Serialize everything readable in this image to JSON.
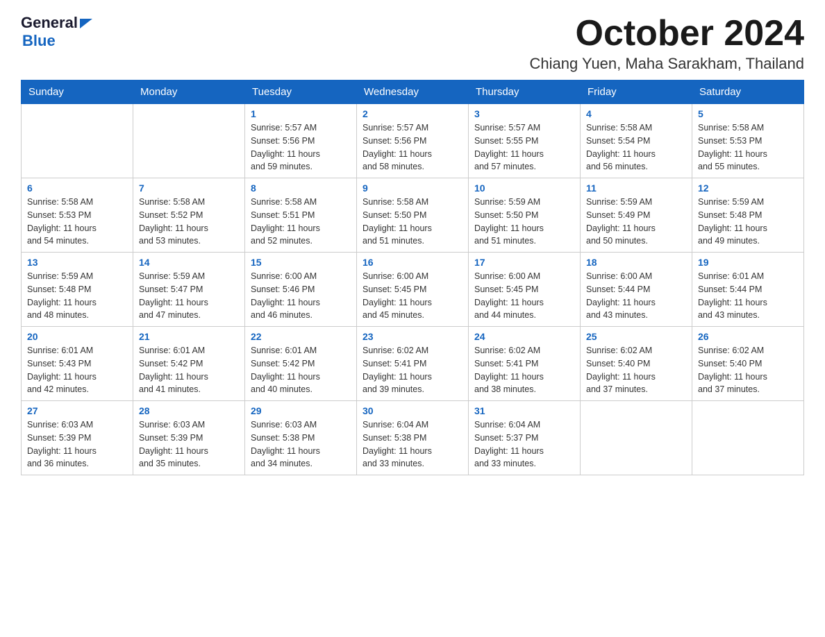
{
  "header": {
    "logo_general": "General",
    "logo_blue": "Blue",
    "title": "October 2024",
    "location": "Chiang Yuen, Maha Sarakham, Thailand"
  },
  "weekdays": [
    "Sunday",
    "Monday",
    "Tuesday",
    "Wednesday",
    "Thursday",
    "Friday",
    "Saturday"
  ],
  "weeks": [
    [
      {
        "day": "",
        "info": ""
      },
      {
        "day": "",
        "info": ""
      },
      {
        "day": "1",
        "info": "Sunrise: 5:57 AM\nSunset: 5:56 PM\nDaylight: 11 hours\nand 59 minutes."
      },
      {
        "day": "2",
        "info": "Sunrise: 5:57 AM\nSunset: 5:56 PM\nDaylight: 11 hours\nand 58 minutes."
      },
      {
        "day": "3",
        "info": "Sunrise: 5:57 AM\nSunset: 5:55 PM\nDaylight: 11 hours\nand 57 minutes."
      },
      {
        "day": "4",
        "info": "Sunrise: 5:58 AM\nSunset: 5:54 PM\nDaylight: 11 hours\nand 56 minutes."
      },
      {
        "day": "5",
        "info": "Sunrise: 5:58 AM\nSunset: 5:53 PM\nDaylight: 11 hours\nand 55 minutes."
      }
    ],
    [
      {
        "day": "6",
        "info": "Sunrise: 5:58 AM\nSunset: 5:53 PM\nDaylight: 11 hours\nand 54 minutes."
      },
      {
        "day": "7",
        "info": "Sunrise: 5:58 AM\nSunset: 5:52 PM\nDaylight: 11 hours\nand 53 minutes."
      },
      {
        "day": "8",
        "info": "Sunrise: 5:58 AM\nSunset: 5:51 PM\nDaylight: 11 hours\nand 52 minutes."
      },
      {
        "day": "9",
        "info": "Sunrise: 5:58 AM\nSunset: 5:50 PM\nDaylight: 11 hours\nand 51 minutes."
      },
      {
        "day": "10",
        "info": "Sunrise: 5:59 AM\nSunset: 5:50 PM\nDaylight: 11 hours\nand 51 minutes."
      },
      {
        "day": "11",
        "info": "Sunrise: 5:59 AM\nSunset: 5:49 PM\nDaylight: 11 hours\nand 50 minutes."
      },
      {
        "day": "12",
        "info": "Sunrise: 5:59 AM\nSunset: 5:48 PM\nDaylight: 11 hours\nand 49 minutes."
      }
    ],
    [
      {
        "day": "13",
        "info": "Sunrise: 5:59 AM\nSunset: 5:48 PM\nDaylight: 11 hours\nand 48 minutes."
      },
      {
        "day": "14",
        "info": "Sunrise: 5:59 AM\nSunset: 5:47 PM\nDaylight: 11 hours\nand 47 minutes."
      },
      {
        "day": "15",
        "info": "Sunrise: 6:00 AM\nSunset: 5:46 PM\nDaylight: 11 hours\nand 46 minutes."
      },
      {
        "day": "16",
        "info": "Sunrise: 6:00 AM\nSunset: 5:45 PM\nDaylight: 11 hours\nand 45 minutes."
      },
      {
        "day": "17",
        "info": "Sunrise: 6:00 AM\nSunset: 5:45 PM\nDaylight: 11 hours\nand 44 minutes."
      },
      {
        "day": "18",
        "info": "Sunrise: 6:00 AM\nSunset: 5:44 PM\nDaylight: 11 hours\nand 43 minutes."
      },
      {
        "day": "19",
        "info": "Sunrise: 6:01 AM\nSunset: 5:44 PM\nDaylight: 11 hours\nand 43 minutes."
      }
    ],
    [
      {
        "day": "20",
        "info": "Sunrise: 6:01 AM\nSunset: 5:43 PM\nDaylight: 11 hours\nand 42 minutes."
      },
      {
        "day": "21",
        "info": "Sunrise: 6:01 AM\nSunset: 5:42 PM\nDaylight: 11 hours\nand 41 minutes."
      },
      {
        "day": "22",
        "info": "Sunrise: 6:01 AM\nSunset: 5:42 PM\nDaylight: 11 hours\nand 40 minutes."
      },
      {
        "day": "23",
        "info": "Sunrise: 6:02 AM\nSunset: 5:41 PM\nDaylight: 11 hours\nand 39 minutes."
      },
      {
        "day": "24",
        "info": "Sunrise: 6:02 AM\nSunset: 5:41 PM\nDaylight: 11 hours\nand 38 minutes."
      },
      {
        "day": "25",
        "info": "Sunrise: 6:02 AM\nSunset: 5:40 PM\nDaylight: 11 hours\nand 37 minutes."
      },
      {
        "day": "26",
        "info": "Sunrise: 6:02 AM\nSunset: 5:40 PM\nDaylight: 11 hours\nand 37 minutes."
      }
    ],
    [
      {
        "day": "27",
        "info": "Sunrise: 6:03 AM\nSunset: 5:39 PM\nDaylight: 11 hours\nand 36 minutes."
      },
      {
        "day": "28",
        "info": "Sunrise: 6:03 AM\nSunset: 5:39 PM\nDaylight: 11 hours\nand 35 minutes."
      },
      {
        "day": "29",
        "info": "Sunrise: 6:03 AM\nSunset: 5:38 PM\nDaylight: 11 hours\nand 34 minutes."
      },
      {
        "day": "30",
        "info": "Sunrise: 6:04 AM\nSunset: 5:38 PM\nDaylight: 11 hours\nand 33 minutes."
      },
      {
        "day": "31",
        "info": "Sunrise: 6:04 AM\nSunset: 5:37 PM\nDaylight: 11 hours\nand 33 minutes."
      },
      {
        "day": "",
        "info": ""
      },
      {
        "day": "",
        "info": ""
      }
    ]
  ]
}
